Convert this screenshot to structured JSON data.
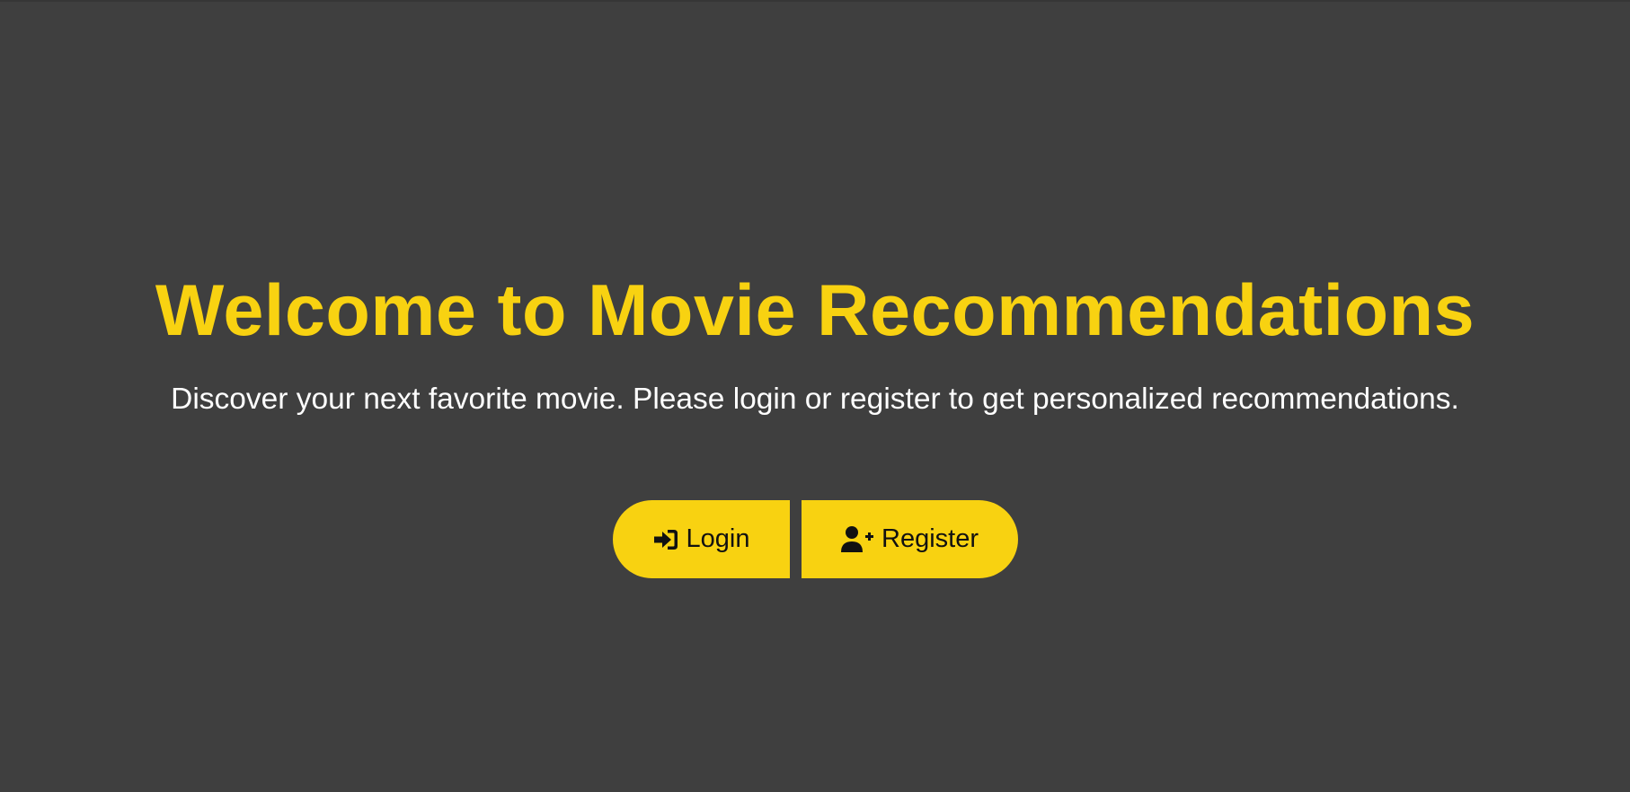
{
  "hero": {
    "title": "Welcome to Movie Recommendations",
    "subtitle": "Discover your next favorite movie. Please login or register to get personalized recommendations."
  },
  "actions": {
    "login": {
      "label": "Login",
      "icon": "sign-in-icon"
    },
    "register": {
      "label": "Register",
      "icon": "user-plus-icon"
    }
  },
  "colors": {
    "background": "#3f3f3f",
    "accent": "#f8d211",
    "subtitle_text": "#ffffff",
    "button_text": "#111111"
  }
}
